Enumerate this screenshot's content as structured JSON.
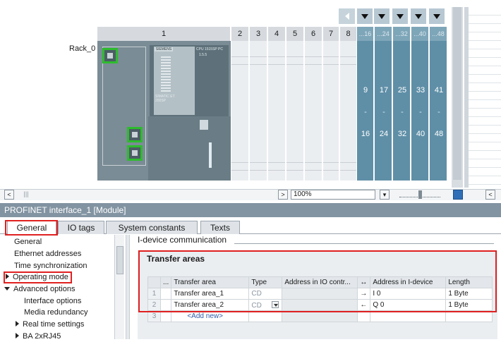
{
  "rack": {
    "label": "Rack_0",
    "slots": [
      "1",
      "2",
      "3",
      "4",
      "5",
      "6",
      "7",
      "8"
    ],
    "ext_headers": [
      "...16",
      "...24",
      "...32",
      "...40",
      "...48"
    ],
    "ext_top": [
      "9",
      "17",
      "25",
      "33",
      "41"
    ],
    "ext_bottom": [
      "16",
      "24",
      "32",
      "40",
      "48"
    ],
    "dash": "-",
    "cpu_brand": "SIEMENS",
    "cpu_model": "CPU 1515SP PC",
    "cpu_text": "SIMATIC ET 200SP",
    "cpu_version": "1.5.5"
  },
  "scroll": {
    "left_btn": "<",
    "grip": "|||",
    "right_btn": ">",
    "zoom": "100%",
    "far_right": "<"
  },
  "properties": {
    "title": "PROFINET interface_1 [Module]",
    "tabs": [
      "General",
      "IO tags",
      "System constants",
      "Texts"
    ],
    "active_tab": "General",
    "nav": [
      {
        "label": "General",
        "level": 0,
        "caret": "none"
      },
      {
        "label": "Ethernet addresses",
        "level": 0,
        "caret": "none"
      },
      {
        "label": "Time synchronization",
        "level": 0,
        "caret": "none"
      },
      {
        "label": "Operating mode",
        "level": 0,
        "caret": "right"
      },
      {
        "label": "Advanced options",
        "level": 0,
        "caret": "down"
      },
      {
        "label": "Interface options",
        "level": 1,
        "caret": "none"
      },
      {
        "label": "Media redundancy",
        "level": 1,
        "caret": "none"
      },
      {
        "label": "Real time settings",
        "level": 1,
        "caret": "right"
      },
      {
        "label": "BA 2xRJ45",
        "level": 1,
        "caret": "right"
      }
    ],
    "section_title": "I-device communication",
    "panel_title": "Transfer areas",
    "table": {
      "headers": [
        "...",
        "Transfer area",
        "Type",
        "Address in IO contr...",
        "Address in I-device",
        "Length"
      ],
      "rows": [
        {
          "num": "1",
          "name": "Transfer area_1",
          "type": "CD",
          "io_addr": "",
          "dir": "→",
          "idev_addr": "I 0",
          "length": "1 Byte"
        },
        {
          "num": "2",
          "name": "Transfer area_2",
          "type": "CD",
          "io_addr": "",
          "dir": "←",
          "idev_addr": "Q 0",
          "length": "1 Byte"
        }
      ],
      "add_row_num": "3",
      "add_new": "<Add new>",
      "dir_header_icon": "↔"
    }
  },
  "colors": {
    "highlight": "#e02020",
    "port_green": "#2ebc2e",
    "title_bar": "#8294a2",
    "ext_slot": "#5f8fa7"
  }
}
